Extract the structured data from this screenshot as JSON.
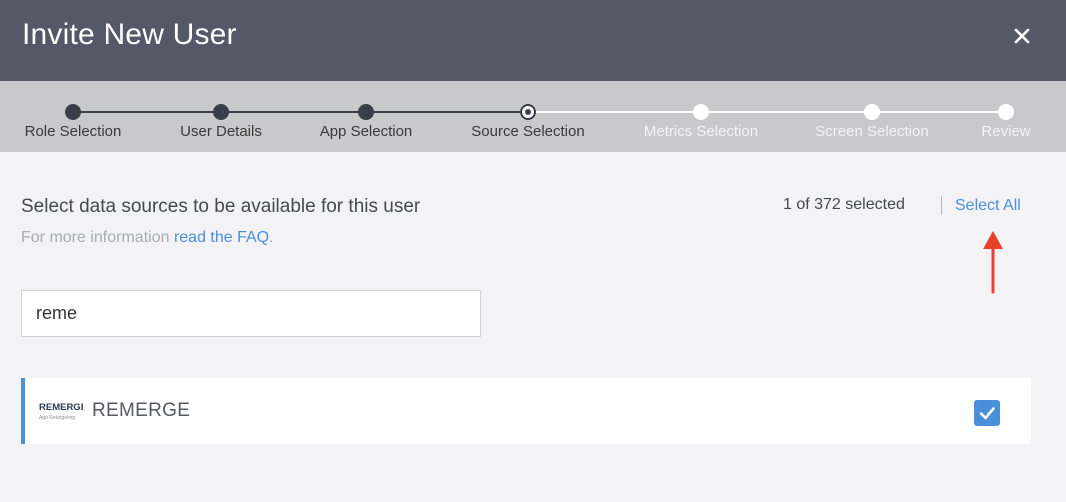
{
  "header": {
    "title": "Invite New User",
    "close_icon": "close-icon"
  },
  "stepper": {
    "steps": [
      {
        "label": "Role Selection",
        "state": "done"
      },
      {
        "label": "User Details",
        "state": "done"
      },
      {
        "label": "App Selection",
        "state": "done"
      },
      {
        "label": "Source Selection",
        "state": "current"
      },
      {
        "label": "Metrics Selection",
        "state": "todo"
      },
      {
        "label": "Screen Selection",
        "state": "todo"
      },
      {
        "label": "Review",
        "state": "todo"
      }
    ]
  },
  "main": {
    "instructions": "Select data sources to be available for this user",
    "faq_prefix": "For more information ",
    "faq_link": "read the FAQ",
    "faq_suffix": ".",
    "selected_count": "1 of 372 selected",
    "select_all": "Select All",
    "search_value": "reme",
    "results": [
      {
        "name": "REMERGE",
        "logo_text": "REMERGE",
        "logo_sub": "App Retargeting",
        "checked": true
      }
    ]
  },
  "colors": {
    "header_bg": "#545967",
    "stepper_bg": "#c9c9cb",
    "accent": "#4a90d9",
    "annotation_arrow": "#e8402c"
  }
}
